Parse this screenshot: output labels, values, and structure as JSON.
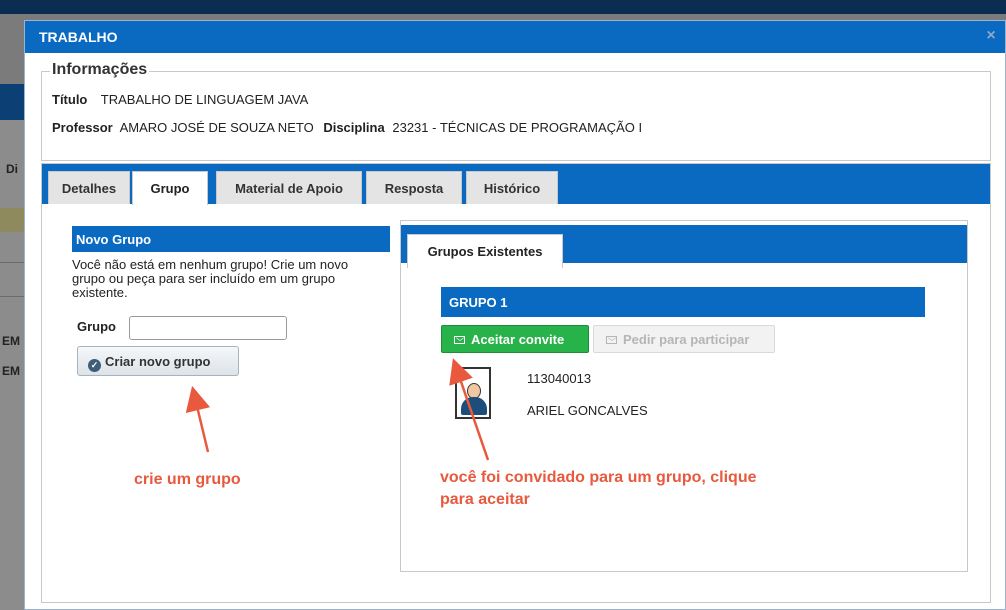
{
  "background": {
    "fragments": [
      "Di",
      "EM",
      "EM"
    ]
  },
  "modal": {
    "title": "TRABALHO",
    "close_glyph": "×",
    "info": {
      "legend": "Informações",
      "titulo_label": "Título",
      "titulo_value": "TRABALHO DE LINGUAGEM JAVA",
      "professor_label": "Professor",
      "professor_value": "AMARO JOSÉ DE SOUZA NETO",
      "disciplina_label": "Disciplina",
      "disciplina_value": "23231 - TÉCNICAS DE PROGRAMAÇÃO I"
    },
    "tabs": [
      {
        "label": "Detalhes",
        "active": false
      },
      {
        "label": "Grupo",
        "active": true
      },
      {
        "label": "Material de Apoio",
        "active": false
      },
      {
        "label": "Resposta",
        "active": false
      },
      {
        "label": "Histórico",
        "active": false
      }
    ],
    "novo_grupo": {
      "title": "Novo Grupo",
      "description": "Você não está em nenhum grupo! Crie um novo grupo ou peça para ser incluído em um grupo existente.",
      "grupo_label": "Grupo",
      "grupo_value": "",
      "criar_button": "Criar novo grupo"
    },
    "grupos_existentes": {
      "tab_label": "Grupos Existentes",
      "group": {
        "name": "GRUPO 1",
        "aceitar_button": "Aceitar convite",
        "pedir_button": "Pedir para participar",
        "member": {
          "id": "113040013",
          "name": "ARIEL GONCALVES"
        }
      }
    }
  },
  "annotations": {
    "left": "crie um grupo",
    "right_line1": "você foi convidado para um grupo, clique",
    "right_line2": "para aceitar",
    "color": "#e8593d"
  },
  "colors": {
    "primary_blue": "#0a6ac2",
    "accept_green": "#28b24a"
  },
  "icons": [
    "close-icon",
    "check-circle-icon",
    "mail-icon",
    "user-avatar-icon"
  ]
}
